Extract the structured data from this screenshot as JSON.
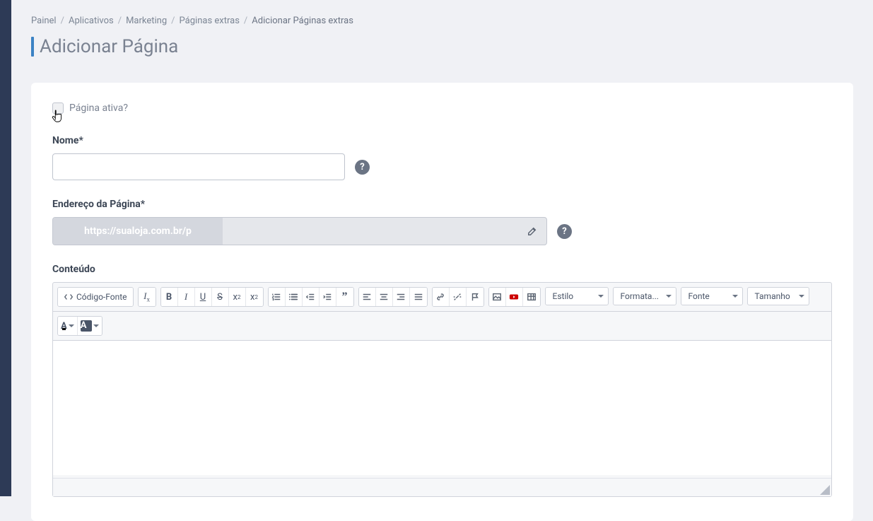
{
  "breadcrumb": {
    "items": [
      "Painel",
      "Aplicativos",
      "Marketing",
      "Páginas extras",
      "Adicionar Páginas extras"
    ]
  },
  "pageTitle": "Adicionar Página",
  "form": {
    "active": {
      "label": "Página ativa?",
      "checked": false
    },
    "name": {
      "label": "Nome*",
      "value": ""
    },
    "url": {
      "label": "Endereço da Página*",
      "prefix": "https://sualoja.com.br/p",
      "value": ""
    },
    "content": {
      "label": "Conteúdo",
      "value": ""
    }
  },
  "editor": {
    "sourceBtn": "Código-Fonte",
    "selects": {
      "style": "Estilo",
      "format": "Formata...",
      "font": "Fonte",
      "size": "Tamanho"
    }
  }
}
